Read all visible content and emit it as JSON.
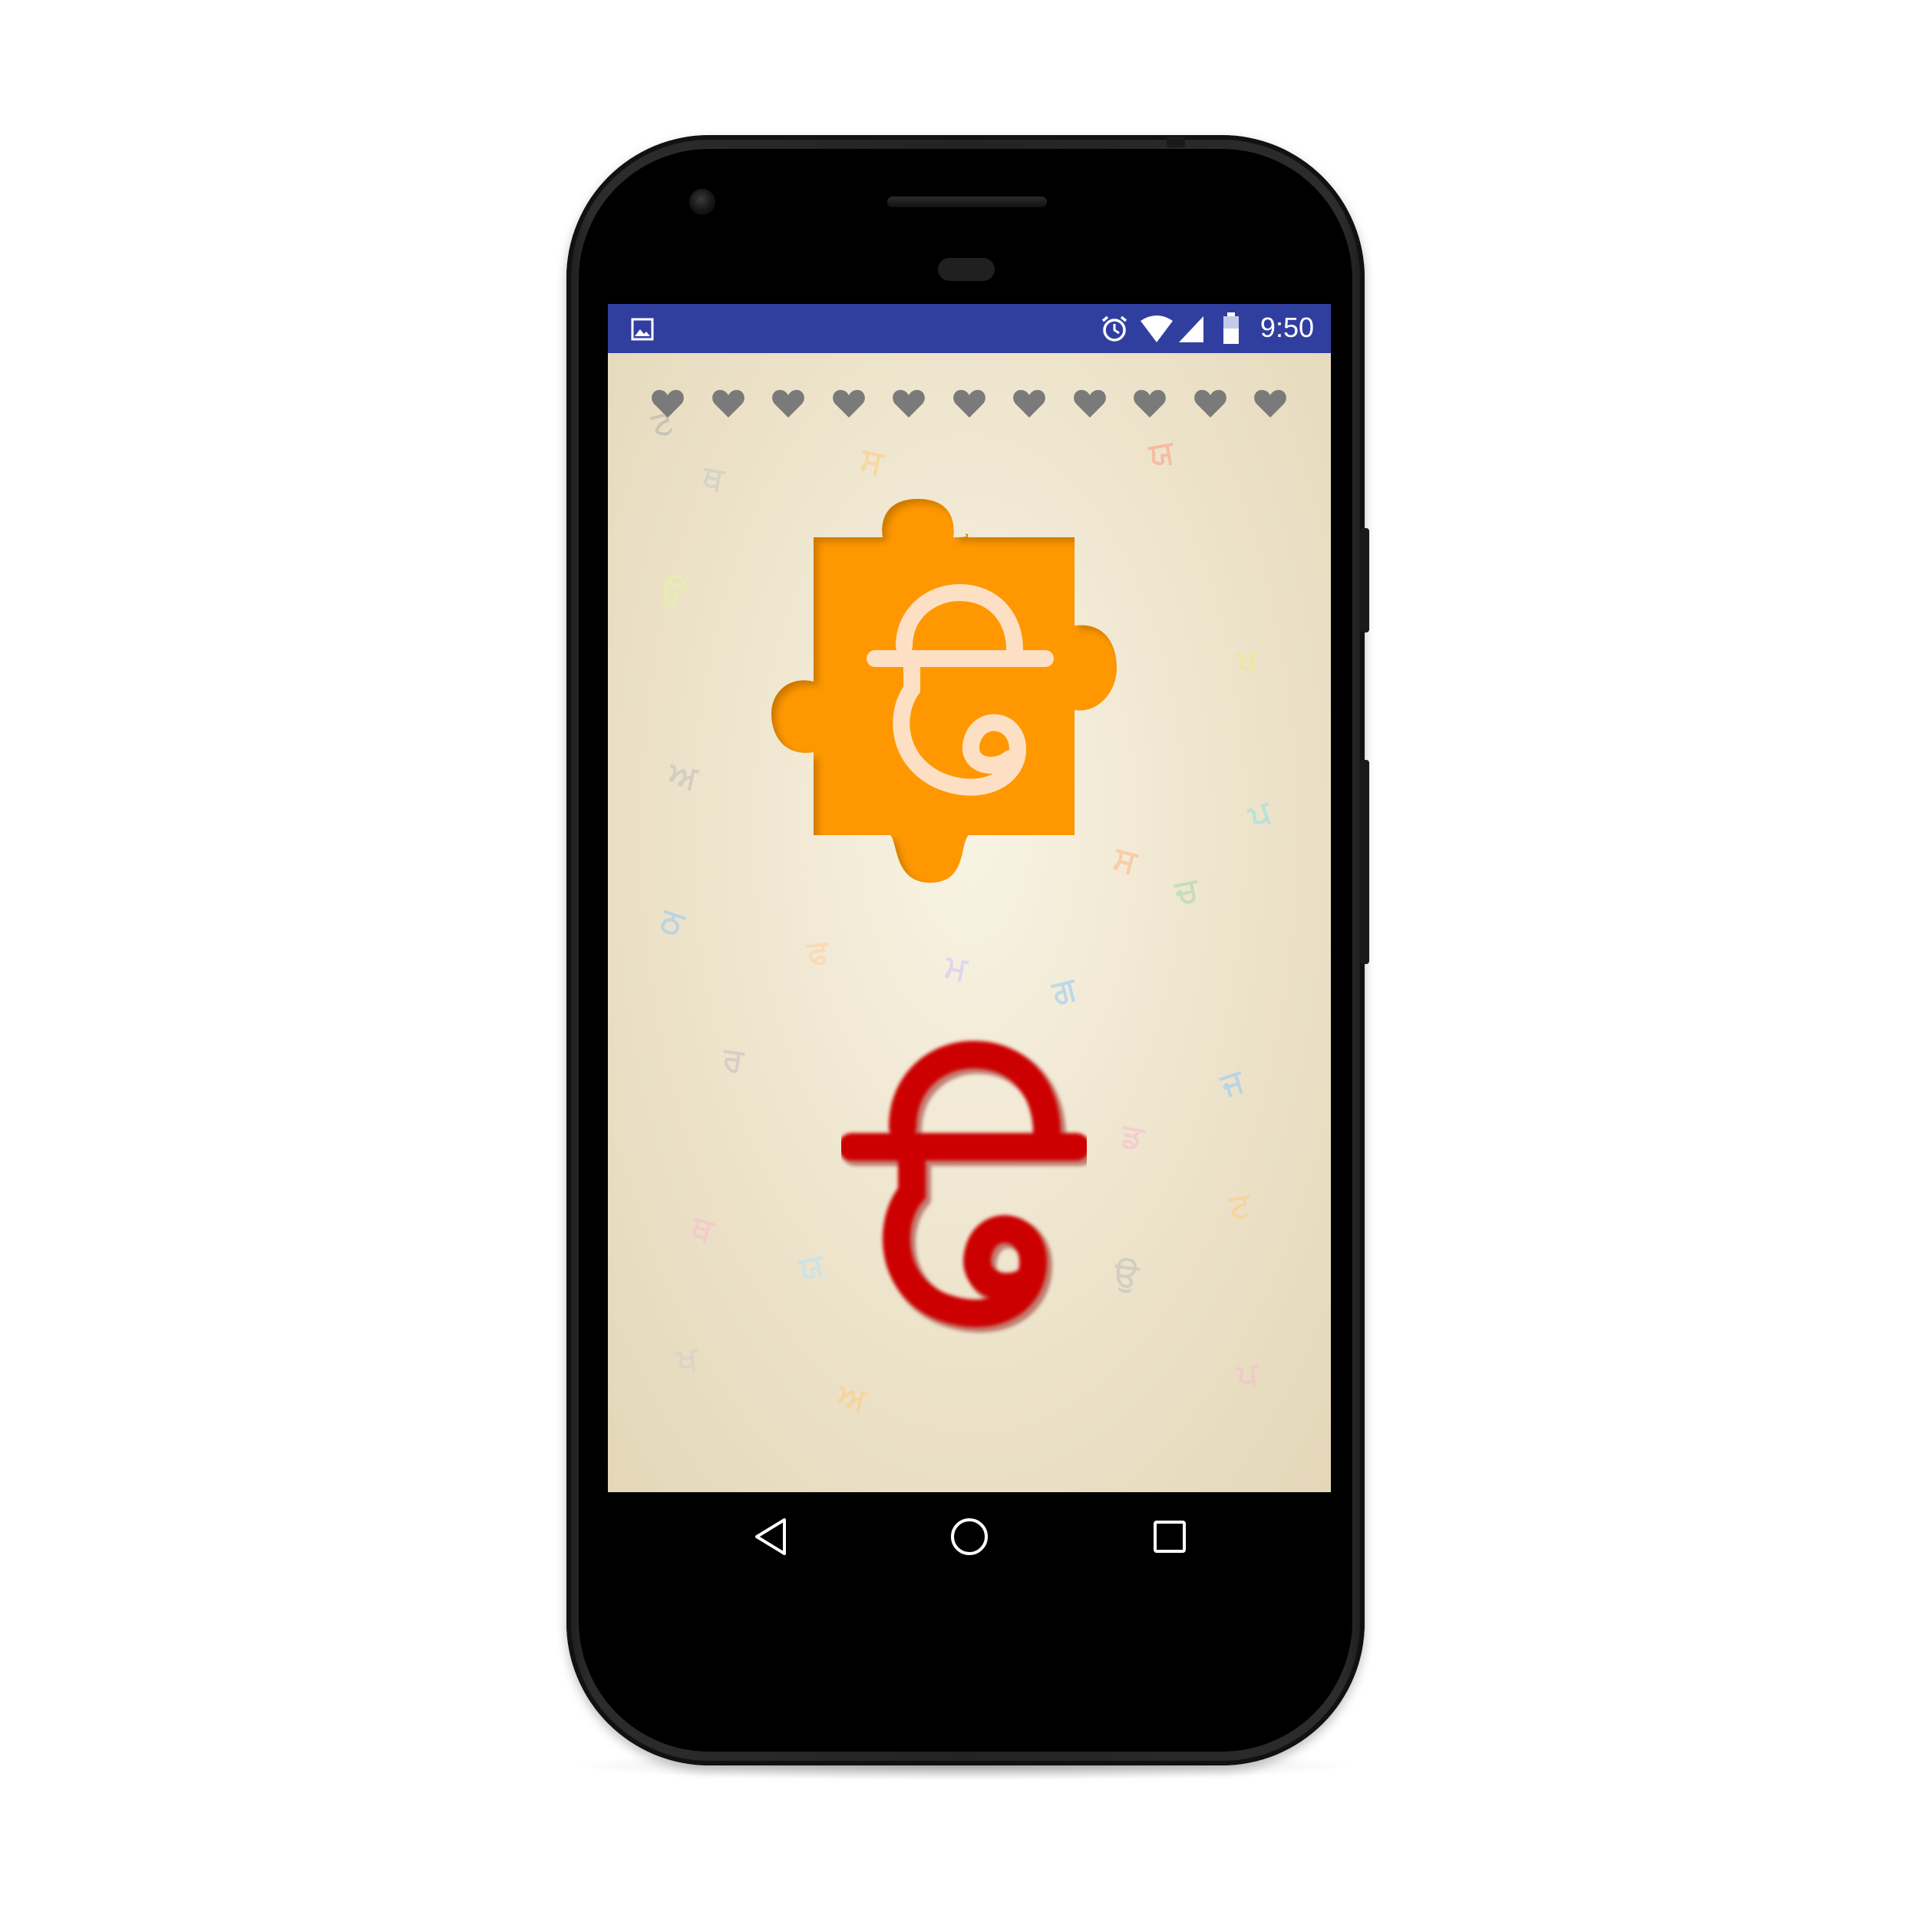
{
  "status_bar": {
    "time": "9:50",
    "icons": [
      "image-notification-icon",
      "alarm-icon",
      "wifi-icon",
      "signal-icon",
      "battery-icon"
    ],
    "color": "#303f9f"
  },
  "game": {
    "lives": 11,
    "heart_color": "#7a7a7a",
    "puzzle_color": "#ff9800",
    "puzzle_letter": "ਉ",
    "puzzle_letter_color": "#fde0c4",
    "answer_letter": "ਉ",
    "answer_letter_color": "#cc0000"
  },
  "background_letters": [
    "ਟ",
    "ਥ",
    "ਯ",
    "ਉ",
    "ਖ",
    "ਅ",
    "ਪ",
    "ਸ",
    "ਚ",
    "ਠ",
    "ਫ",
    "ਮ",
    "ਗ",
    "ਰ",
    "ਜ",
    "ਡ"
  ],
  "navigation": {
    "icons": [
      "back-icon",
      "home-icon",
      "recents-icon"
    ]
  }
}
